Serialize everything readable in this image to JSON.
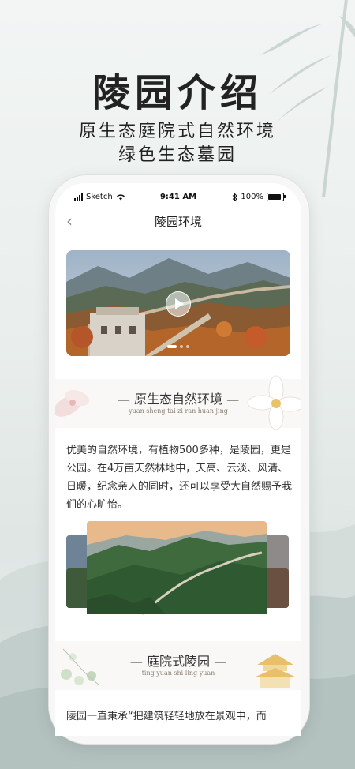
{
  "hero": {
    "title": "陵园介绍",
    "subtitle_line1": "原生态庭院式自然环境",
    "subtitle_line2": "绿色生态墓园"
  },
  "status_bar": {
    "carrier": "Sketch",
    "time": "9:41 AM",
    "battery": "100%"
  },
  "nav": {
    "back_icon": "chevron-left-icon",
    "title": "陵园环境"
  },
  "video": {
    "play_icon": "play-icon",
    "pages": 3,
    "active_page": 1
  },
  "section1": {
    "title": "— 原生态自然环境 —",
    "pinyin": "yuan sheng tai zi ran huan jing",
    "text": "优美的自然环境，有植物500多种，是陵园，更是公园。在4万亩天然林地中，天高、云淡、风清、日暖，纪念亲人的同时，还可以享受大自然赐予我们的心旷怡。"
  },
  "section2": {
    "title": "— 庭院式陵园 —",
    "pinyin": "ting yuan shi ling yuan",
    "text": "陵园一直秉承“把建筑轻轻地放在景观中，而"
  },
  "colors": {
    "text_dark": "#222222",
    "section_bg": "#faf8f6",
    "pinyin": "#8a7f74"
  }
}
